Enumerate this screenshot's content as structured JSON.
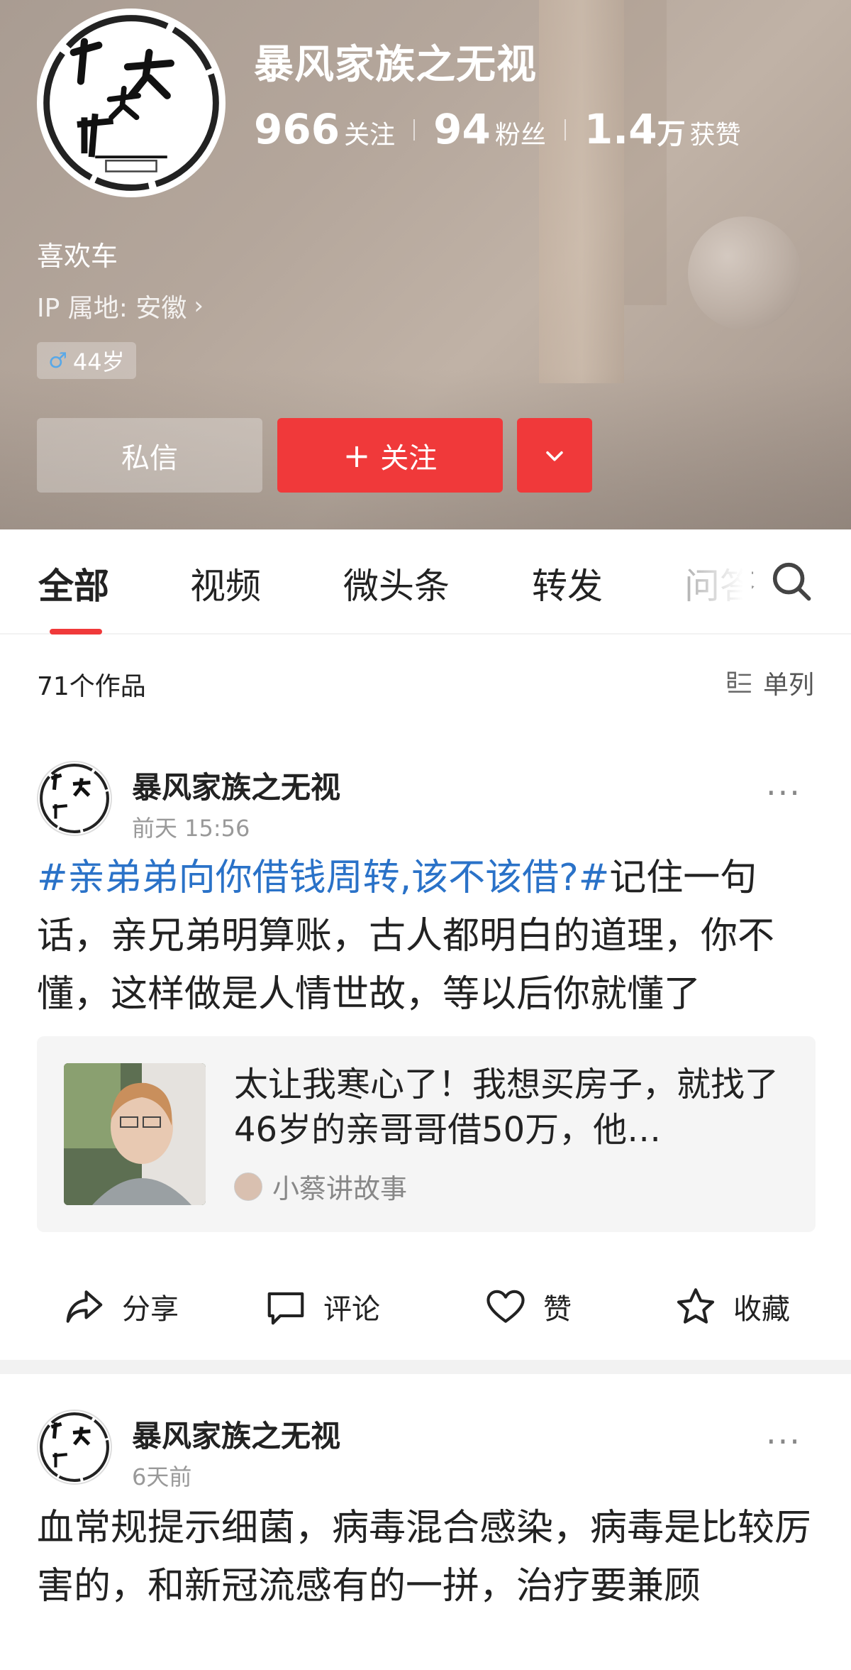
{
  "profile": {
    "nickname": "暴风家族之无视",
    "stats": [
      {
        "num": "966",
        "unit": "",
        "label": "关注"
      },
      {
        "num": "94",
        "unit": "",
        "label": "粉丝"
      },
      {
        "num": "1.4",
        "unit": "万",
        "label": "获赞"
      }
    ],
    "bio": "喜欢车",
    "ip_location": "IP 属地: 安徽",
    "age_badge": "44岁",
    "buttons": {
      "message": "私信",
      "follow": "关注",
      "follow_plus": "+",
      "more_icon": "chevron-down-icon"
    }
  },
  "tabs": [
    {
      "label": "全部",
      "active": true
    },
    {
      "label": "视频",
      "active": false
    },
    {
      "label": "微头条",
      "active": false
    },
    {
      "label": "转发",
      "active": false
    },
    {
      "label": "问答",
      "active": false
    }
  ],
  "list_header": {
    "count_text": "71个作品",
    "layout_toggle": "单列"
  },
  "posts": [
    {
      "author": "暴风家族之无视",
      "time": "前天  15:56",
      "hashtag": "#亲弟弟向你借钱周转,该不该借?#",
      "text": "记住一句话，亲兄弟明算账，古人都明白的道理，你不懂，这样做是人情世故，等以后你就懂了",
      "quote": {
        "text": "太让我寒心了！我想买房子，就找了46岁的亲哥哥借50万，他…",
        "source": "小蔡讲故事"
      },
      "actions": [
        {
          "label": "分享",
          "icon": "share-icon"
        },
        {
          "label": "评论",
          "icon": "comment-icon"
        },
        {
          "label": "赞",
          "icon": "like-icon"
        },
        {
          "label": "收藏",
          "icon": "star-icon"
        }
      ]
    },
    {
      "author": "暴风家族之无视",
      "time": "6天前",
      "text": "血常规提示细菌，病毒混合感染，病毒是比较厉害的，和新冠流感有的一拼，治疗要兼顾"
    }
  ],
  "colors": {
    "accent_red": "#f0393a",
    "hashtag_blue": "#2a72c8"
  }
}
